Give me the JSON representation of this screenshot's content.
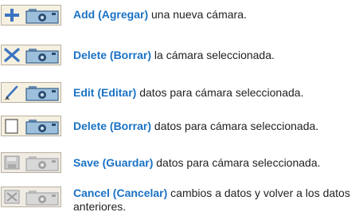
{
  "accent_color": "#1a72c4",
  "rows": [
    {
      "icon": "add-plus-icon",
      "keyword": "Add (Agregar)",
      "text": " una nueva cámara."
    },
    {
      "icon": "delete-x-icon",
      "keyword": "Delete (Borrar)",
      "text": " la cámara seleccionada."
    },
    {
      "icon": "edit-pencil-icon",
      "keyword": "Edit (Editar)",
      "text": " datos para cámara seleccionada."
    },
    {
      "icon": "delete-data-icon",
      "keyword": "Delete (Borrar)",
      "text": " datos para cámara seleccionada."
    },
    {
      "icon": "save-disk-icon",
      "keyword": "Save (Guardar)",
      "text": " datos para cámara seleccionada."
    },
    {
      "icon": "cancel-icon",
      "keyword": "Cancel (Cancelar)",
      "text": " cambios a datos y volver a los datos anteriores."
    }
  ]
}
